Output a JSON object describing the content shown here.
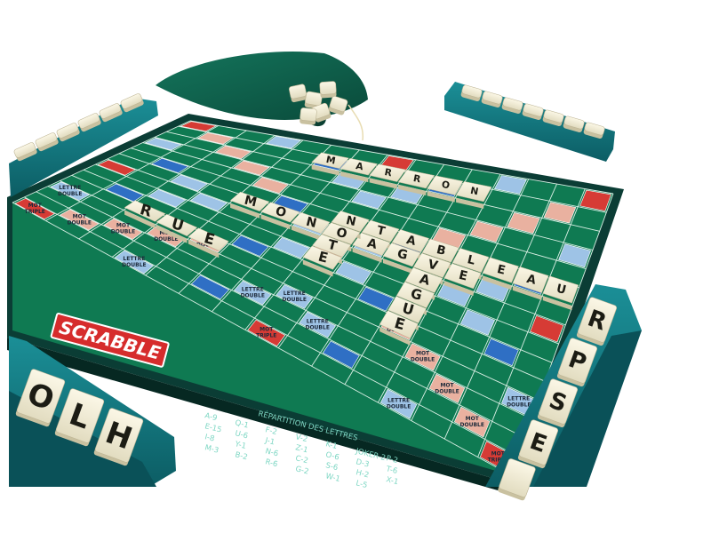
{
  "brand": {
    "logo_text": "SCRABBLE"
  },
  "colors": {
    "board_green": "#0f7a52",
    "frame_dark": "#0b3d35",
    "rack_teal": "#137a82",
    "tile_ivory": "#f4efd8",
    "double_word": "#e9b1a0",
    "triple_word": "#d63b35",
    "double_letter": "#9ec3e6",
    "triple_letter": "#2f6fc4",
    "bag_green": "#0d5a46"
  },
  "premium_labels": {
    "double_word": [
      "MOT",
      "DOUBLE"
    ],
    "triple_word": [
      "MOT",
      "TRIPLE"
    ],
    "double_letter": [
      "LETTRE",
      "DOUBLE"
    ]
  },
  "words": {
    "w1": "MARRON",
    "w2": "TABLEAU",
    "w3": "MONTAGNE",
    "w4": "VAGUE",
    "w5": "NOTE",
    "w6": "RUE"
  },
  "racks": {
    "left_front": [
      "O",
      "L",
      "H"
    ],
    "right_front": [
      "R",
      "P",
      "S",
      "E"
    ]
  },
  "legend": {
    "title": "RÉPARTITION DES LETTRES",
    "entries": [
      "A-9",
      "E-15",
      "I-8",
      "M-3",
      "Q-1",
      "U-6",
      "Y-1",
      "B-2",
      "F-2",
      "J-1",
      "N-6",
      "R-6",
      "V-2",
      "Z-1",
      "C-2",
      "G-2",
      "K-1",
      "O-6",
      "S-6",
      "W-1",
      "JOKER-2",
      "D-3",
      "H-2",
      "L-5",
      "P-2",
      "T-6",
      "X-1"
    ]
  }
}
